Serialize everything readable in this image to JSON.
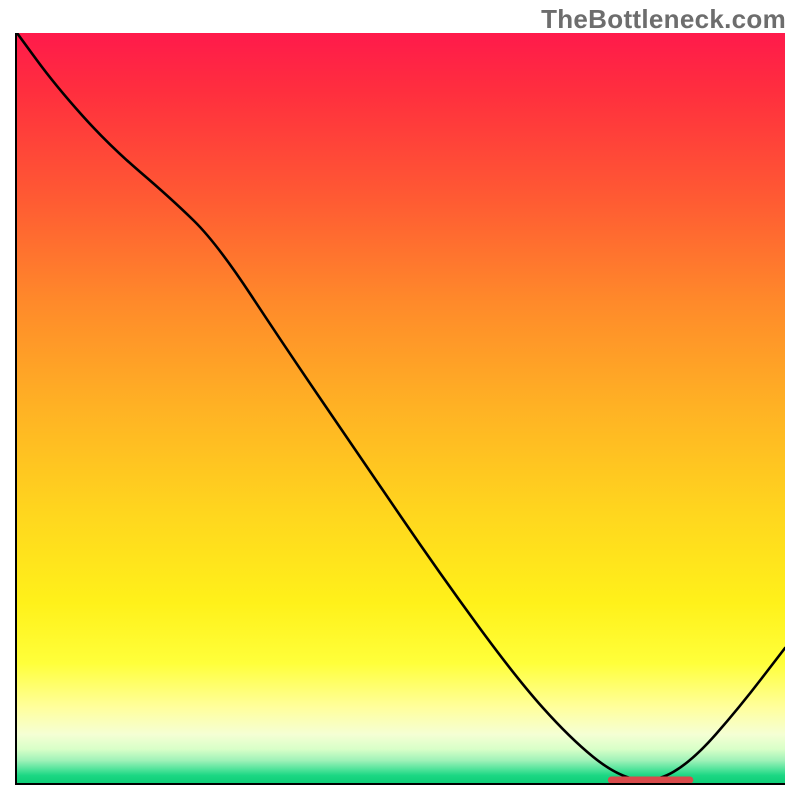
{
  "watermark": "TheBottleneck.com",
  "colors": {
    "top": "#ff1a4b",
    "mid": "#ffd61e",
    "bottom": "#0fce78",
    "curve": "#000000",
    "marker": "#d84b4b"
  },
  "chart_data": {
    "type": "line",
    "x": [
      0.0,
      0.05,
      0.12,
      0.2,
      0.26,
      0.35,
      0.45,
      0.55,
      0.65,
      0.72,
      0.78,
      0.83,
      0.88,
      0.94,
      1.0
    ],
    "y": [
      1.0,
      0.93,
      0.85,
      0.78,
      0.72,
      0.58,
      0.43,
      0.28,
      0.14,
      0.06,
      0.01,
      0.0,
      0.03,
      0.1,
      0.18
    ],
    "xlim": [
      0,
      1
    ],
    "ylim": [
      0,
      1
    ],
    "xlabel": "",
    "ylabel": "",
    "title": "",
    "marker_band": {
      "x_start": 0.77,
      "x_end": 0.88,
      "y": 0.004
    }
  }
}
